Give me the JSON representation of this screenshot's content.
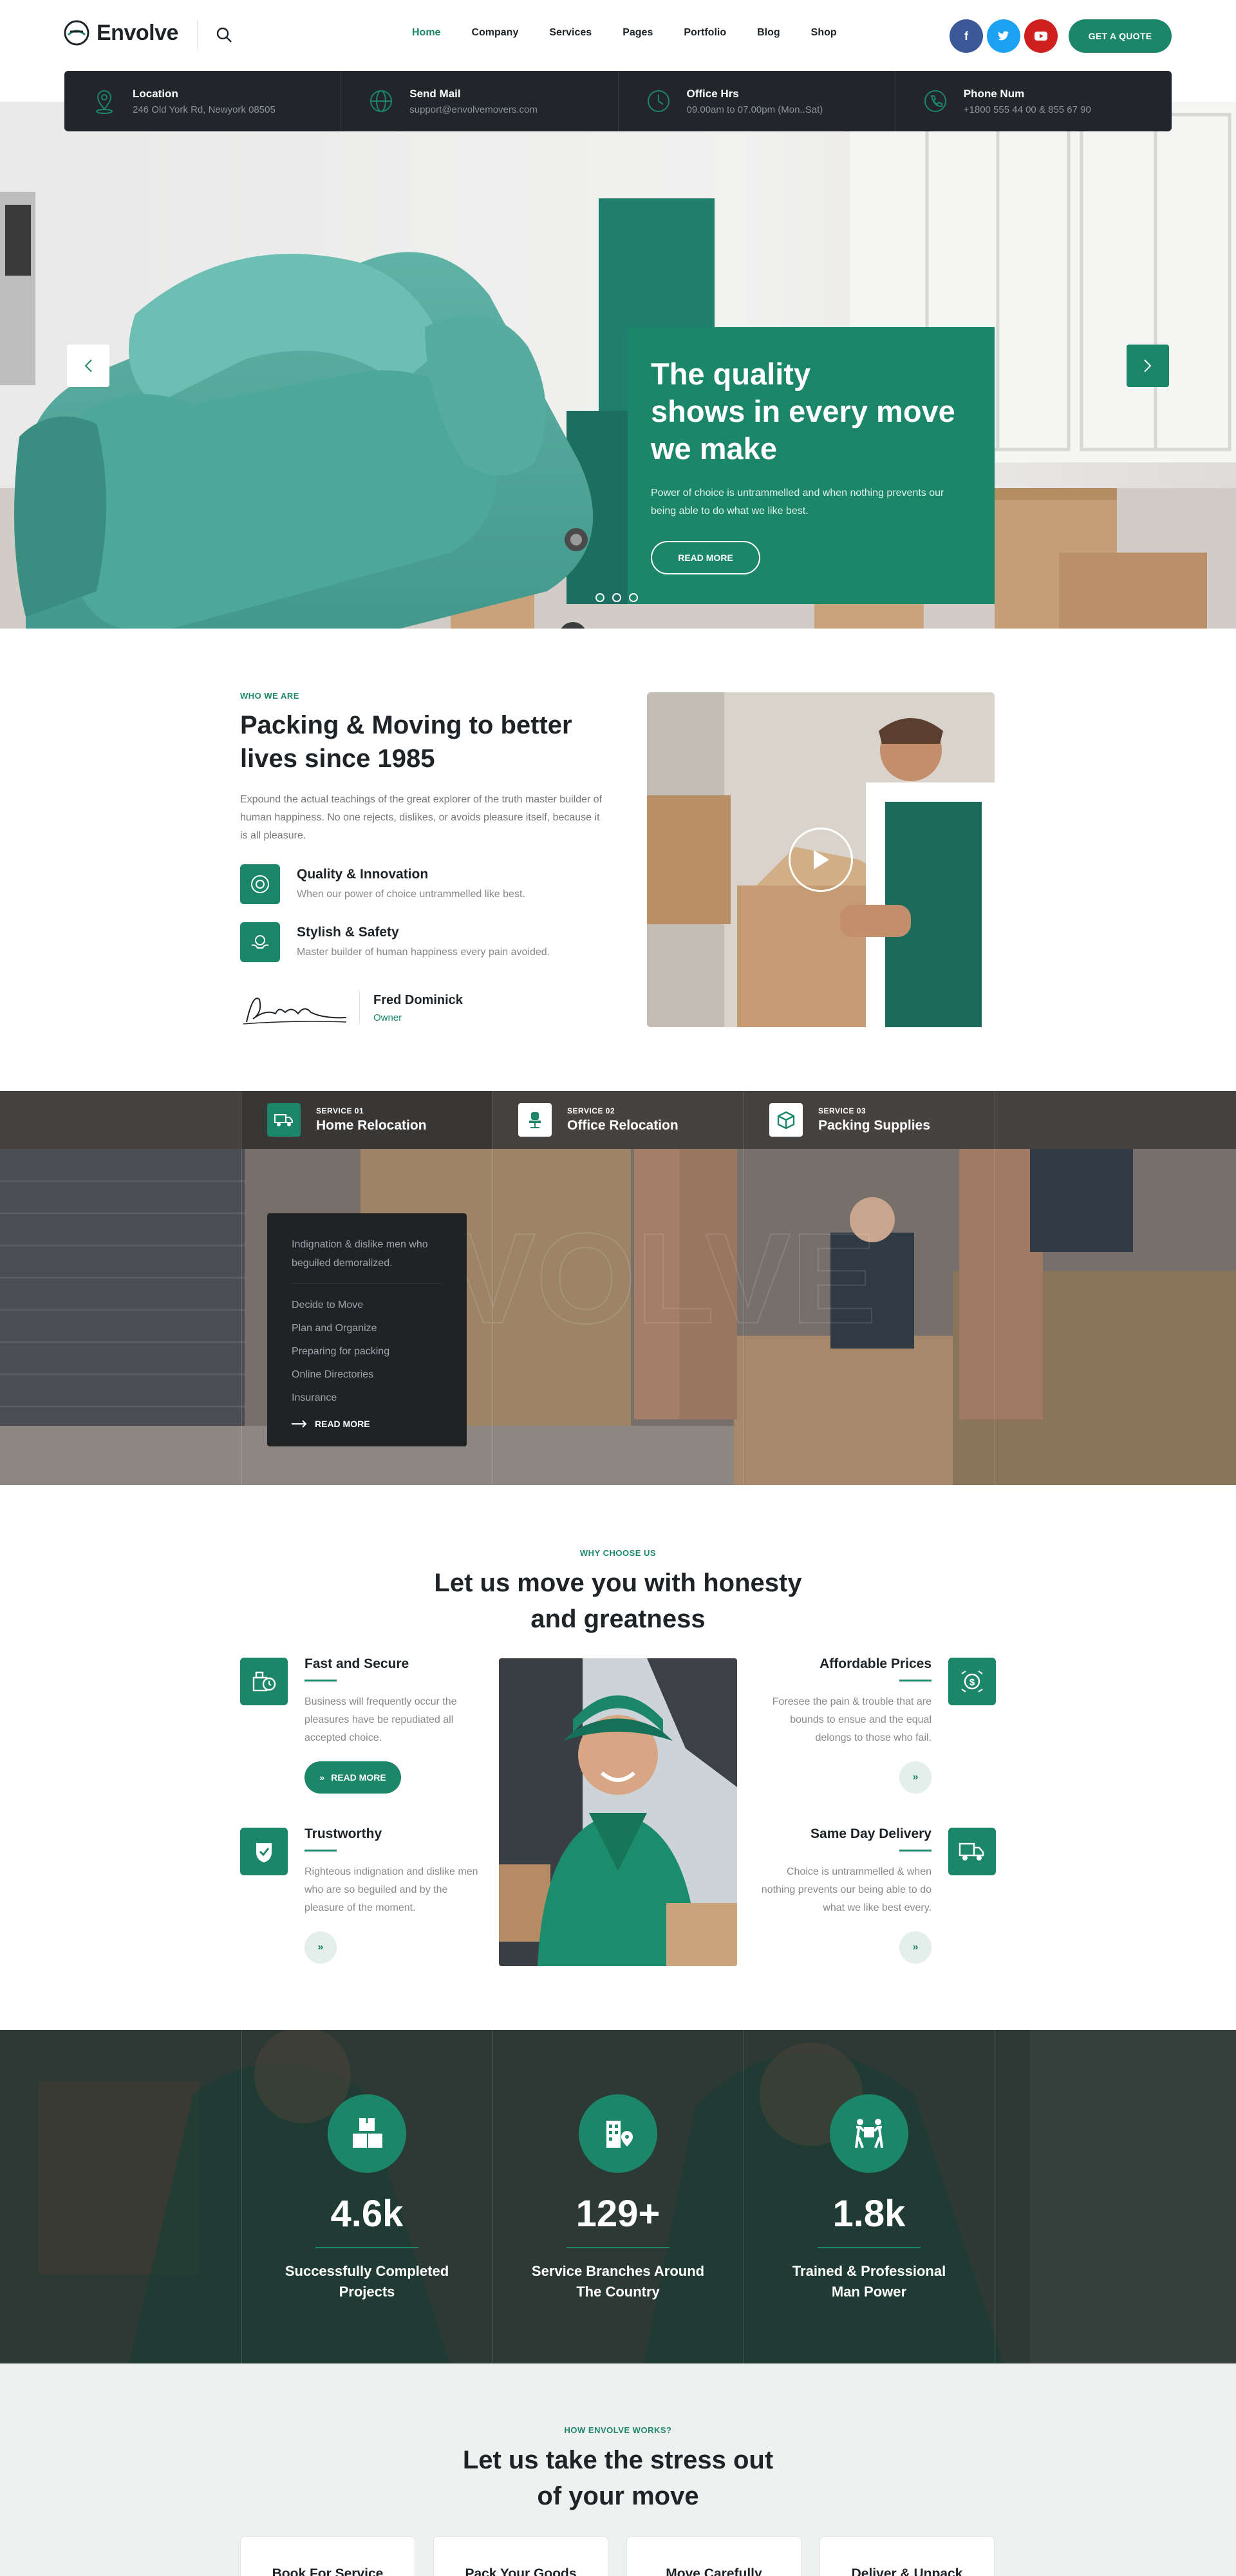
{
  "brand": {
    "name": "Envolve",
    "green": "#1b8668",
    "dark": "#22262a"
  },
  "nav": {
    "items": [
      "Home",
      "Company",
      "Services",
      "Pages",
      "Portfolio",
      "Blog",
      "Shop"
    ],
    "active": "Home"
  },
  "header": {
    "social": [
      "f",
      "t",
      "yt"
    ],
    "quote_label": "GET A QUOTE"
  },
  "info": [
    {
      "title": "Location",
      "value": "246 Old York Rd, Newyork 08505",
      "icon": "map-pin-icon"
    },
    {
      "title": "Send Mail",
      "value": "support@envolvemovers.com",
      "icon": "globe-icon"
    },
    {
      "title": "Office Hrs",
      "value": "09.00am to 07.00pm (Mon..Sat)",
      "icon": "clock-icon"
    },
    {
      "title": "Phone Num",
      "value": "+1800 555 44 00 &  855 67 90",
      "icon": "phone-icon"
    }
  ],
  "hero": {
    "title_l1": "The quality",
    "title_l2": "shows in every move",
    "title_l3": "we make",
    "text": "Power of choice is untrammelled and when nothing prevents our being able to do what we like best.",
    "button": "READ MORE",
    "slides": 3,
    "active_slide": 1
  },
  "about": {
    "eyebrow": "WHO WE ARE",
    "title": "Packing & Moving to better lives since 1985",
    "text": "Expound the actual teachings of the great explorer of the truth master builder of human happiness. No one rejects, dislikes, or avoids pleasure itself, because it is all pleasure.",
    "features": [
      {
        "title": "Quality & Innovation",
        "text": "When our power of choice untrammelled like best."
      },
      {
        "title": "Stylish & Safety",
        "text": "Master builder of human happiness every pain avoided."
      }
    ],
    "owner_name": "Fred Dominick",
    "owner_role": "Owner"
  },
  "services": {
    "tabs": [
      {
        "label": "SERVICE 01",
        "name": "Home Relocation",
        "icon": "truck-icon"
      },
      {
        "label": "SERVICE 02",
        "name": "Office Relocation",
        "icon": "office-chair-icon"
      },
      {
        "label": "SERVICE 03",
        "name": "Packing Supplies",
        "icon": "box-icon"
      }
    ],
    "box_text": "Indignation & dislike men who beguiled demoralized.",
    "list": [
      "Decide to Move",
      "Plan and Organize",
      "Preparing for packing",
      "Online Directories",
      "Insurance"
    ],
    "more": "READ MORE"
  },
  "why": {
    "eyebrow": "WHY CHOOSE US",
    "title_l1": "Let us move you with honesty",
    "title_l2": "and greatness",
    "items": [
      {
        "title": "Fast and Secure",
        "text": "Business will frequently occur the pleasures have  be repudiated all accepted choice.",
        "icon": "stopwatch-box-icon"
      },
      {
        "title": "Affordable Prices",
        "text": "Foresee the pain & trouble that are bounds to ensue and the equal delongs to those who fail.",
        "icon": "price-icon"
      },
      {
        "title": "Trustworthy",
        "text": "Righteous indignation and dislike men who are so beguiled and by the pleasure of the moment.",
        "icon": "shield-check-icon"
      },
      {
        "title": "Same Day Delivery",
        "text": "Choice is untrammelled & when nothing prevents our being able to do what we like best every.",
        "icon": "delivery-truck-icon"
      }
    ],
    "read_more": "READ MORE"
  },
  "counters": [
    {
      "value": "4.6k",
      "label_l1": "Successfully Completed",
      "label_l2": "Projects",
      "icon": "boxes-icon"
    },
    {
      "value": "129+",
      "label_l1": "Service Branches Around",
      "label_l2": "The Country",
      "icon": "building-pin-icon"
    },
    {
      "value": "1.8k",
      "label_l1": "Trained & Professional",
      "label_l2": "Man Power",
      "icon": "carry-box-icon"
    }
  ],
  "how": {
    "eyebrow": "HOW ENVOLVE WORKS?",
    "title_l1": "Let us take the stress out",
    "title_l2": "of your move",
    "steps": [
      "Book For Service",
      "Pack Your Goods",
      "Move Carefully",
      "Deliver & Unpack"
    ]
  }
}
